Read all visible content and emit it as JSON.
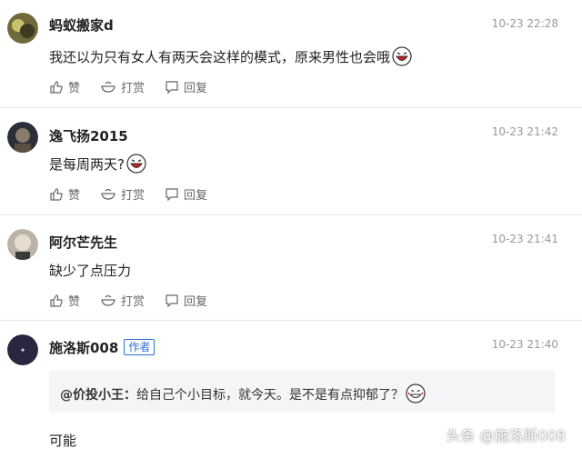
{
  "comments": [
    {
      "name": "蚂蚁搬家d",
      "time": "10-23 22:28",
      "text": "我还以为只有女人有两天会这样的模式，原来男性也会哦",
      "emoji": "laughing-emoji"
    },
    {
      "name": "逸飞扬2015",
      "time": "10-23 21:42",
      "text": "是每周两天?",
      "emoji": "laughing-emoji"
    },
    {
      "name": "阿尔芒先生",
      "time": "10-23 21:41",
      "text": "缺少了点压力",
      "emoji": ""
    },
    {
      "name": "施洛斯008",
      "badge": "作者",
      "time": "10-23 21:40",
      "text": "可能",
      "reply": {
        "user": "@价投小王",
        "separator": "：",
        "text": "给自己个小目标，就今天。是不是有点抑郁了？",
        "emoji": "grinning-emoji"
      }
    }
  ],
  "actions": {
    "like": "赞",
    "tip": "打赏",
    "reply": "回复"
  },
  "watermark": "头条 @施洛斯008",
  "colors": {
    "author_badge": "#2a6fd6",
    "time": "#999999",
    "reply_bg": "#f4f5f6"
  }
}
